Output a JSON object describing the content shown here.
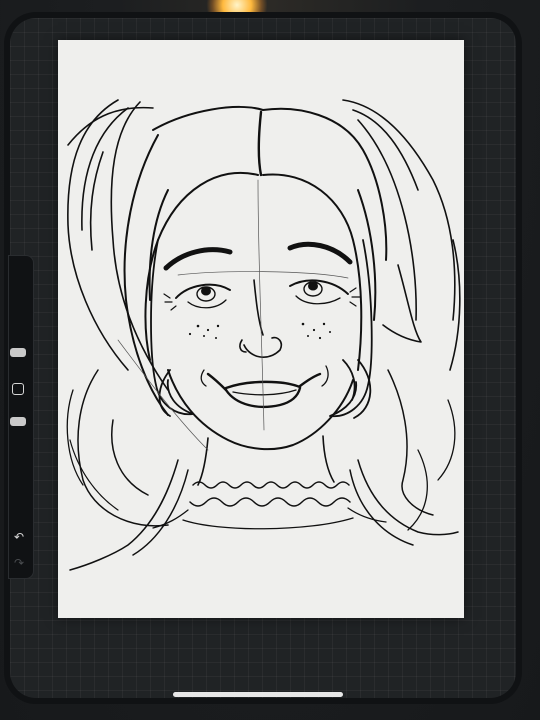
{
  "app": {
    "canvas_background": "#efefed",
    "ink_color": "#111111",
    "screen_color": "#202325"
  },
  "sidebar": {
    "brush_size_slider": {
      "icon": "slider-handle"
    },
    "modify_button": {
      "icon": "square-outline-icon"
    },
    "opacity_slider": {
      "icon": "slider-handle"
    },
    "undo_button": {
      "icon": "undo-arrow-icon",
      "glyph": "↶"
    },
    "redo_button": {
      "icon": "redo-arrow-icon",
      "glyph": "↷"
    }
  },
  "artwork": {
    "subject": "sketch"
  }
}
